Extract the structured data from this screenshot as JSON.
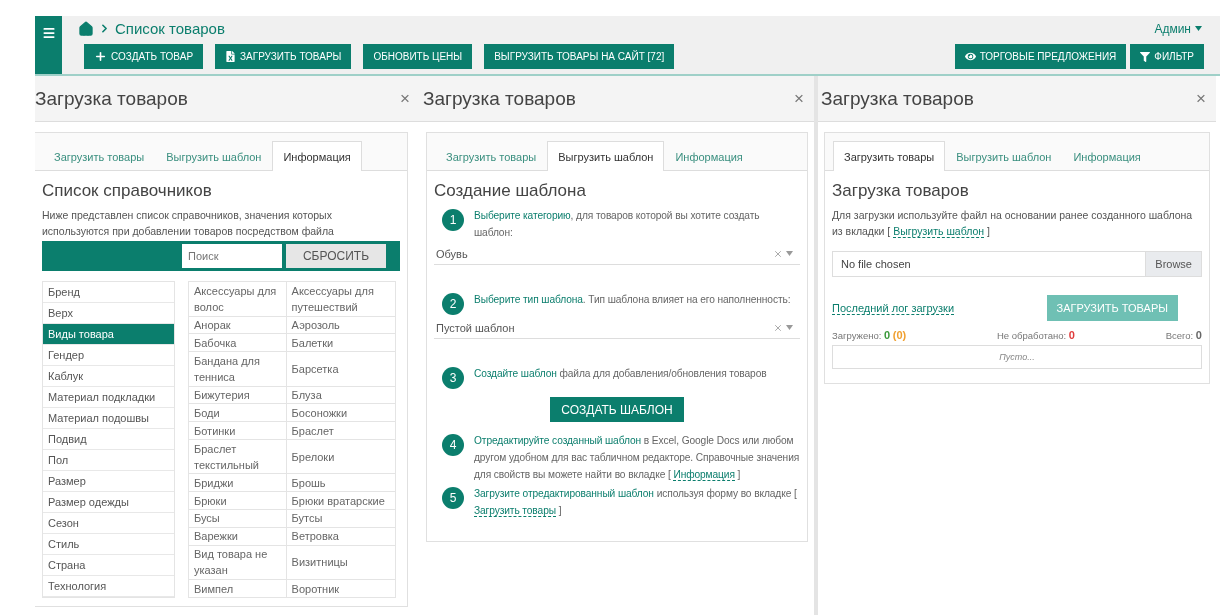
{
  "header": {
    "breadcrumb": "Список товаров",
    "user": "Админ",
    "actions": [
      {
        "label": "СОЗДАТЬ ТОВАР"
      },
      {
        "label": "ЗАГРУЗИТЬ ТОВАРЫ"
      },
      {
        "label": "ОБНОВИТЬ ЦЕНЫ"
      },
      {
        "label": "ВЫГРУЗИТЬ ТОВАРЫ НА САЙТ [72]"
      }
    ],
    "right_actions": [
      {
        "label": "ТОРГОВЫЕ ПРЕДЛОЖЕНИЯ"
      },
      {
        "label": "ФИЛЬТР"
      }
    ]
  },
  "panels": [
    {
      "kind": "reference",
      "title": "Загрузка товаров",
      "close": "×",
      "tabs": [
        {
          "label": "Загрузить товары",
          "selected": false
        },
        {
          "label": "Выгрузить шаблон",
          "selected": false
        },
        {
          "label": "Информация",
          "selected": true
        }
      ],
      "heading": "Список справочников",
      "description": "Ниже представлен список справочников, значения которых используются при добавлении товаров посредством файла",
      "search": {
        "placeholder": "Поиск"
      },
      "reset": "СБРОСИТЬ",
      "directories": [
        {
          "label": "Бренд",
          "selected": false
        },
        {
          "label": "Верх",
          "selected": false
        },
        {
          "label": "Виды товара",
          "selected": true
        },
        {
          "label": "Гендер",
          "selected": false
        },
        {
          "label": "Каблук",
          "selected": false
        },
        {
          "label": "Материал подкладки",
          "selected": false
        },
        {
          "label": "Материал подошвы",
          "selected": false
        },
        {
          "label": "Подвид",
          "selected": false
        },
        {
          "label": "Пол",
          "selected": false
        },
        {
          "label": "Размер",
          "selected": false
        },
        {
          "label": "Размер одежды",
          "selected": false
        },
        {
          "label": "Сезон",
          "selected": false
        },
        {
          "label": "Стиль",
          "selected": false
        },
        {
          "label": "Страна",
          "selected": false
        },
        {
          "label": "Технология",
          "selected": false
        }
      ],
      "values": [
        [
          "Аксессуары для волос",
          "Аксессуары для путешествий"
        ],
        [
          "Анорак",
          "Аэрозоль"
        ],
        [
          "Бабочка",
          "Балетки"
        ],
        [
          "Бандана для тенниса",
          "Барсетка"
        ],
        [
          "Бижутерия",
          "Блуза"
        ],
        [
          "Боди",
          "Босоножки"
        ],
        [
          "Ботинки",
          "Браслет"
        ],
        [
          "Браслет текстильный",
          "Брелоки"
        ],
        [
          "Бриджи",
          "Брошь"
        ],
        [
          "Брюки",
          "Брюки вратарские"
        ],
        [
          "Бусы",
          "Бутсы"
        ],
        [
          "Варежки",
          "Ветровка"
        ],
        [
          "Вид товара не указан",
          "Визитницы"
        ],
        [
          "Вимпел",
          "Воротник"
        ]
      ]
    },
    {
      "kind": "template",
      "title": "Загрузка товаров",
      "close": "×",
      "tabs": [
        {
          "label": "Загрузить товары",
          "selected": false
        },
        {
          "label": "Выгрузить шаблон",
          "selected": true
        },
        {
          "label": "Информация",
          "selected": false
        }
      ],
      "heading": "Создание шаблона",
      "steps": [
        {
          "number": "1",
          "link": "Выберите категорию",
          "text": ", для товаров которой вы хотите создать шаблон:",
          "select": "Обувь"
        },
        {
          "number": "2",
          "link": "Выберите тип шаблона",
          "text": ". Тип шаблона влияет на его наполненность:",
          "select": "Пустой шаблон"
        },
        {
          "number": "3",
          "link": "Создайте шаблон",
          "text": " файла для добавления/обновления товаров",
          "button": "СОЗДАТЬ ШАБЛОН"
        },
        {
          "number": "4",
          "link": "Отредактируйте созданный шаблон",
          "text": " в Excel, Google Docs или любом другом удобном для вас табличном редакторе. Справочные значения для свойств вы можете найти во вкладке [ ",
          "tab_link": "Информация",
          "after": " ]"
        },
        {
          "number": "5",
          "link": "Загрузите отредактированный шаблон",
          "text": " используя форму во вкладке [ ",
          "tab_link": "Загрузить товары",
          "after": " ]"
        }
      ]
    },
    {
      "kind": "upload",
      "title": "Загрузка товаров",
      "close": "×",
      "tabs": [
        {
          "label": "Загрузить товары",
          "selected": true
        },
        {
          "label": "Выгрузить шаблон",
          "selected": false
        },
        {
          "label": "Информация",
          "selected": false
        }
      ],
      "heading": "Загрузка товаров",
      "description": "Для загрузки используйте файл на основании ранее созданного шаблона из вкладки [ ",
      "tab_link": "Выгрузить шаблон",
      "after": " ]",
      "file": {
        "value": "No file chosen",
        "browse": "Browse"
      },
      "log_link": "Последний лог загрузки",
      "submit": {
        "label": "ЗАГРУЗИТЬ ТОВАРЫ",
        "disabled": true
      },
      "stats": [
        {
          "label": "Загружено:",
          "values": [
            {
              "text": "0",
              "color": "#3c9a3c"
            },
            {
              "text": "(0)",
              "color": "#f0a030"
            }
          ]
        },
        {
          "label": "Не обработано:",
          "values": [
            {
              "text": "0",
              "color": "#e03b3b"
            }
          ]
        },
        {
          "label": "Всего:",
          "values": [
            {
              "text": "0",
              "color": "#666666"
            }
          ]
        }
      ],
      "empty": "Пусто..."
    }
  ]
}
